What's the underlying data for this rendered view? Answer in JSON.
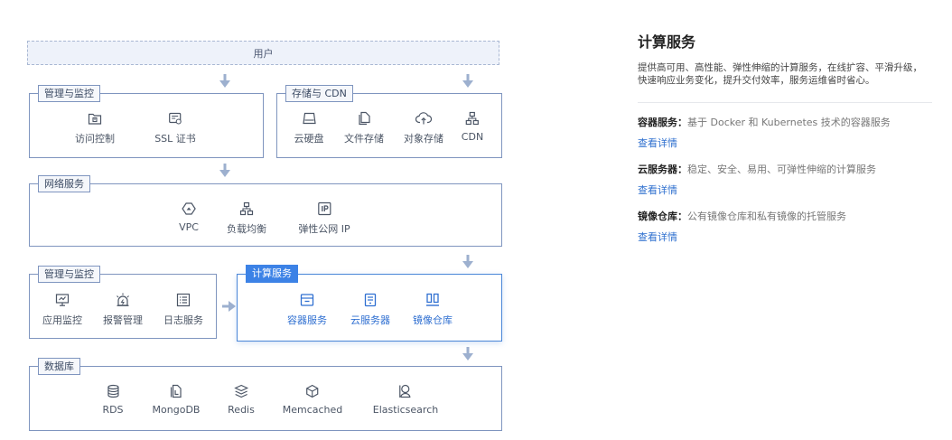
{
  "diagram": {
    "user_label": "用户",
    "groups": {
      "mgmt_top": {
        "label": "管理与监控",
        "items": [
          {
            "icon": "access-control-icon",
            "label": "访问控制"
          },
          {
            "icon": "ssl-certificate-icon",
            "label": "SSL 证书"
          }
        ]
      },
      "storage": {
        "label": "存储与 CDN",
        "items": [
          {
            "icon": "cloud-disk-icon",
            "label": "云硬盘"
          },
          {
            "icon": "file-storage-icon",
            "label": "文件存储"
          },
          {
            "icon": "object-storage-icon",
            "label": "对象存储"
          },
          {
            "icon": "cdn-icon",
            "label": "CDN"
          }
        ]
      },
      "network": {
        "label": "网络服务",
        "items": [
          {
            "icon": "vpc-icon",
            "label": "VPC"
          },
          {
            "icon": "load-balancer-icon",
            "label": "负载均衡"
          },
          {
            "icon": "elastic-ip-icon",
            "label": "弹性公网 IP"
          }
        ]
      },
      "mgmt_bottom": {
        "label": "管理与监控",
        "items": [
          {
            "icon": "app-monitor-icon",
            "label": "应用监控"
          },
          {
            "icon": "alarm-icon",
            "label": "报警管理"
          },
          {
            "icon": "log-service-icon",
            "label": "日志服务"
          }
        ]
      },
      "compute": {
        "label": "计算服务",
        "items": [
          {
            "icon": "container-service-icon",
            "label": "容器服务"
          },
          {
            "icon": "cloud-server-icon",
            "label": "云服务器"
          },
          {
            "icon": "image-registry-icon",
            "label": "镜像仓库"
          }
        ]
      },
      "database": {
        "label": "数据库",
        "items": [
          {
            "icon": "rds-icon",
            "label": "RDS"
          },
          {
            "icon": "mongodb-icon",
            "label": "MongoDB"
          },
          {
            "icon": "redis-icon",
            "label": "Redis"
          },
          {
            "icon": "memcached-icon",
            "label": "Memcached"
          },
          {
            "icon": "elasticsearch-icon",
            "label": "Elasticsearch"
          }
        ]
      }
    },
    "colors": {
      "border": "#7f95bf",
      "active": "#3c82e6",
      "arrow": "#9db0cf"
    }
  },
  "panel": {
    "title": "计算服务",
    "description": "提供高可用、高性能、弹性伸缩的计算服务，在线扩容、平滑升级，快速响应业务变化，提升交付效率，服务运维省时省心。",
    "services": [
      {
        "name": "容器服务：",
        "desc": "基于 Docker 和 Kubernetes 技术的容器服务",
        "link": "查看详情"
      },
      {
        "name": "云服务器：",
        "desc": "稳定、安全、易用、可弹性伸缩的计算服务",
        "link": "查看详情"
      },
      {
        "name": "镜像仓库：",
        "desc": "公有镜像仓库和私有镜像的托管服务",
        "link": "查看详情"
      }
    ]
  }
}
